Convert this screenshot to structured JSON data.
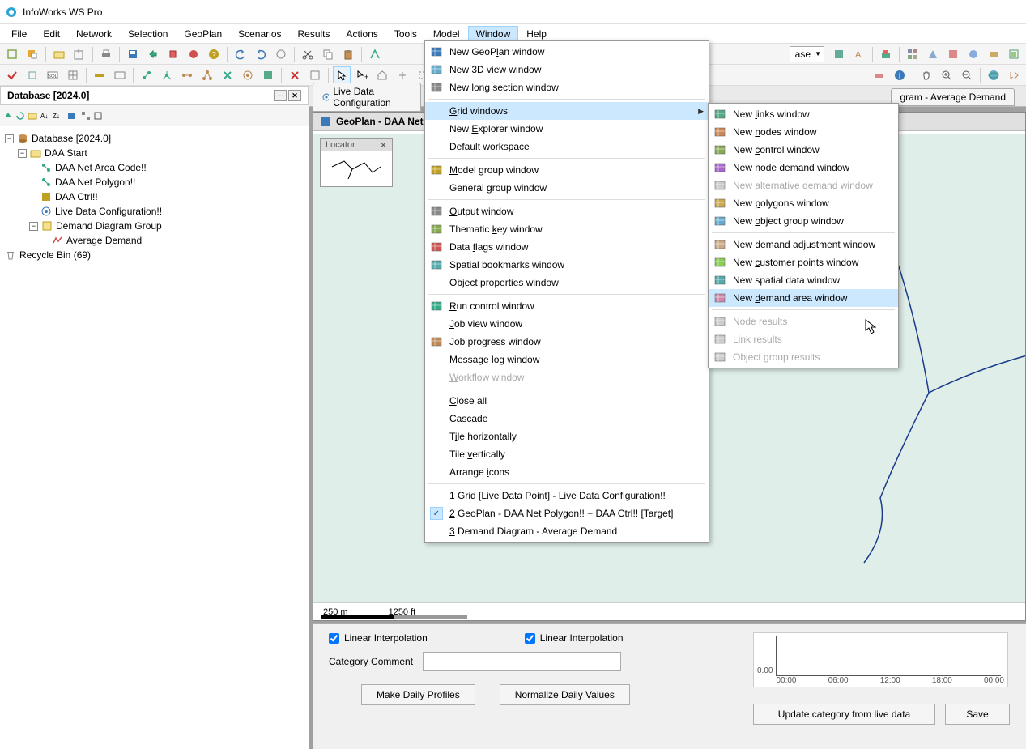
{
  "title": "InfoWorks WS Pro",
  "menus": [
    "File",
    "Edit",
    "Network",
    "Selection",
    "GeoPlan",
    "Scenarios",
    "Results",
    "Actions",
    "Tools",
    "Model",
    "Window",
    "Help"
  ],
  "active_menu": "Window",
  "leftPanel": {
    "title": "Database [2024.0]",
    "tree": {
      "root": "Database [2024.0]",
      "daa_start": "DAA Start",
      "area_code": "DAA Net Area Code!!",
      "polygon": "DAA Net Polygon!!",
      "ctrl": "DAA Ctrl!!",
      "live_data": "Live Data Configuration!!",
      "demand_group": "Demand Diagram Group",
      "avg_demand": "Average Demand",
      "recycle": "Recycle Bin (69)"
    }
  },
  "tabs": {
    "live_data": "Live Data Configuration",
    "geoplan": "GeoPlan - DAA Net P",
    "demand": "gram - Average Demand"
  },
  "locator_title": "Locator",
  "scale": {
    "m": "250 m",
    "ft": "1250 ft"
  },
  "bottom": {
    "linear1": "Linear Interpolation",
    "linear2": "Linear Interpolation",
    "category_comment_label": "Category Comment",
    "make_daily": "Make Daily Profiles",
    "normalize": "Normalize Daily Values",
    "update": "Update category from live data",
    "save": "Save"
  },
  "chart_data": {
    "type": "line",
    "title": "",
    "xlabel": "",
    "ylabel": "",
    "x_ticks": [
      "00:00",
      "06:00",
      "12:00",
      "18:00",
      "00:00"
    ],
    "y_ticks": [
      "0.00"
    ],
    "series": []
  },
  "window_menu": {
    "items": [
      {
        "label": "New GeoPlan window",
        "icon": "geoplan",
        "u": 8
      },
      {
        "label": "New 3D view window",
        "icon": "3d",
        "u": 4
      },
      {
        "label": "New long section window",
        "icon": "section"
      },
      {
        "sep": true
      },
      {
        "label": "Grid windows",
        "submenu": true,
        "highlighted": true,
        "u": 0
      },
      {
        "label": "New Explorer window",
        "u": 4
      },
      {
        "label": "Default workspace"
      },
      {
        "sep": true
      },
      {
        "label": "Model group window",
        "icon": "model",
        "u": 0
      },
      {
        "label": "General group window"
      },
      {
        "sep": true
      },
      {
        "label": "Output window",
        "icon": "output",
        "u": 0
      },
      {
        "label": "Thematic key window",
        "icon": "thematic",
        "u": 9
      },
      {
        "label": "Data flags window",
        "icon": "flags",
        "u": 5
      },
      {
        "label": "Spatial bookmarks window",
        "icon": "spatial"
      },
      {
        "label": "Object properties window"
      },
      {
        "sep": true
      },
      {
        "label": "Run control window",
        "icon": "run",
        "u": 0
      },
      {
        "label": "Job view window",
        "u": 0
      },
      {
        "label": "Job progress window",
        "icon": "progress"
      },
      {
        "label": "Message log window",
        "u": 0
      },
      {
        "label": "Workflow window",
        "disabled": true,
        "u": 0
      },
      {
        "sep": true
      },
      {
        "label": "Close all",
        "u": 0
      },
      {
        "label": "Cascade"
      },
      {
        "label": "Tile horizontally",
        "u": 1
      },
      {
        "label": "Tile vertically",
        "u": 5
      },
      {
        "label": "Arrange icons",
        "u": 8
      },
      {
        "sep": true
      },
      {
        "label": "1 Grid [Live Data Point] - Live Data Configuration!!",
        "u": 0
      },
      {
        "label": "2 GeoPlan - DAA Net Polygon!! + DAA Ctrl!! [Target]",
        "checked": true,
        "u": 0
      },
      {
        "label": "3 Demand Diagram - Average Demand",
        "u": 0
      }
    ]
  },
  "grid_submenu": {
    "items": [
      {
        "label": "New links window",
        "icon": "links",
        "u": 4
      },
      {
        "label": "New nodes window",
        "icon": "nodes",
        "u": 4
      },
      {
        "label": "New control window",
        "icon": "control",
        "u": 4
      },
      {
        "label": "New node demand window",
        "icon": "demand"
      },
      {
        "label": "New alternative demand window",
        "icon": "alt",
        "disabled": true
      },
      {
        "label": "New polygons window",
        "icon": "poly",
        "u": 4
      },
      {
        "label": "New object group window",
        "icon": "group",
        "u": 4
      },
      {
        "sep": true
      },
      {
        "label": "New demand adjustment window",
        "icon": "adj",
        "u": 4
      },
      {
        "label": "New customer points window",
        "icon": "cust",
        "u": 4
      },
      {
        "label": "New spatial data window",
        "icon": "spatial"
      },
      {
        "label": "New demand area window",
        "icon": "area",
        "highlighted": true,
        "u": 4
      },
      {
        "sep": true
      },
      {
        "label": "Node results",
        "icon": "nres",
        "disabled": true
      },
      {
        "label": "Link results",
        "icon": "lres",
        "disabled": true
      },
      {
        "label": "Object group results",
        "icon": "ores",
        "disabled": true
      }
    ]
  },
  "dropdown_partial": "ase"
}
